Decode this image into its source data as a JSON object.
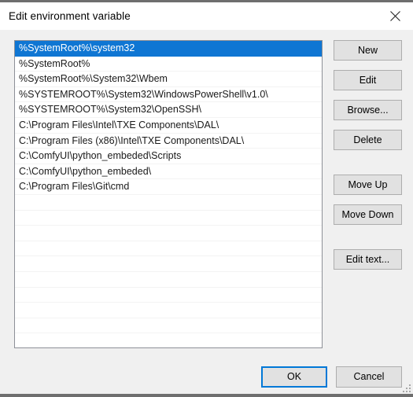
{
  "window": {
    "title": "Edit environment variable",
    "close_icon": "close-icon"
  },
  "colors": {
    "selection": "#0f76d3",
    "focus_border": "#0078d7",
    "dialog_bg": "#f0f0f0",
    "button_face": "#e1e1e1",
    "list_border": "#8d9097"
  },
  "list": {
    "selected_index": 0,
    "visible_empty_rows": 10,
    "items": [
      "%SystemRoot%\\system32",
      "%SystemRoot%",
      "%SystemRoot%\\System32\\Wbem",
      "%SYSTEMROOT%\\System32\\WindowsPowerShell\\v1.0\\",
      "%SYSTEMROOT%\\System32\\OpenSSH\\",
      "C:\\Program Files\\Intel\\TXE Components\\DAL\\",
      "C:\\Program Files (x86)\\Intel\\TXE Components\\DAL\\",
      "C:\\ComfyUI\\python_embeded\\Scripts",
      "C:\\ComfyUI\\python_embeded\\",
      "C:\\Program Files\\Git\\cmd"
    ]
  },
  "side_buttons": [
    {
      "label": "New",
      "name": "new-button",
      "group_gap": false
    },
    {
      "label": "Edit",
      "name": "edit-button",
      "group_gap": false
    },
    {
      "label": "Browse...",
      "name": "browse-button",
      "group_gap": false
    },
    {
      "label": "Delete",
      "name": "delete-button",
      "group_gap": false
    },
    {
      "label": "Move Up",
      "name": "move-up-button",
      "group_gap": true
    },
    {
      "label": "Move Down",
      "name": "move-down-button",
      "group_gap": false
    },
    {
      "label": "Edit text...",
      "name": "edit-text-button",
      "group_gap": true
    }
  ],
  "bottom_buttons": {
    "ok": "OK",
    "cancel": "Cancel"
  }
}
